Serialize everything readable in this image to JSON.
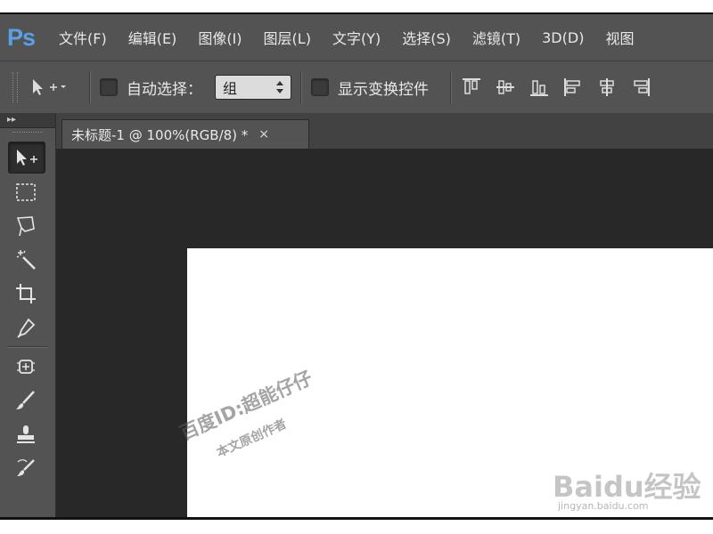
{
  "app": {
    "logo": "Ps"
  },
  "menu": {
    "items": [
      "文件(F)",
      "编辑(E)",
      "图像(I)",
      "图层(L)",
      "文字(Y)",
      "选择(S)",
      "滤镜(T)",
      "3D(D)",
      "视图"
    ]
  },
  "options": {
    "auto_select_label": "自动选择：",
    "auto_select_checked": false,
    "group_select_value": "组",
    "show_transform_label": "显示变换控件",
    "show_transform_checked": false
  },
  "document": {
    "tab_title": "未标题-1 @ 100%(RGB/8) *",
    "close_glyph": "×"
  },
  "watermarks": {
    "line1": "百度ID:超能仔仔",
    "line2": "本文原创作者",
    "baidu_logo": "Baidu经验",
    "baidu_url": "jingyan.baidu.com"
  },
  "colors": {
    "accent": "#5aa0e6",
    "panel": "#535353",
    "workspace": "#282828"
  }
}
